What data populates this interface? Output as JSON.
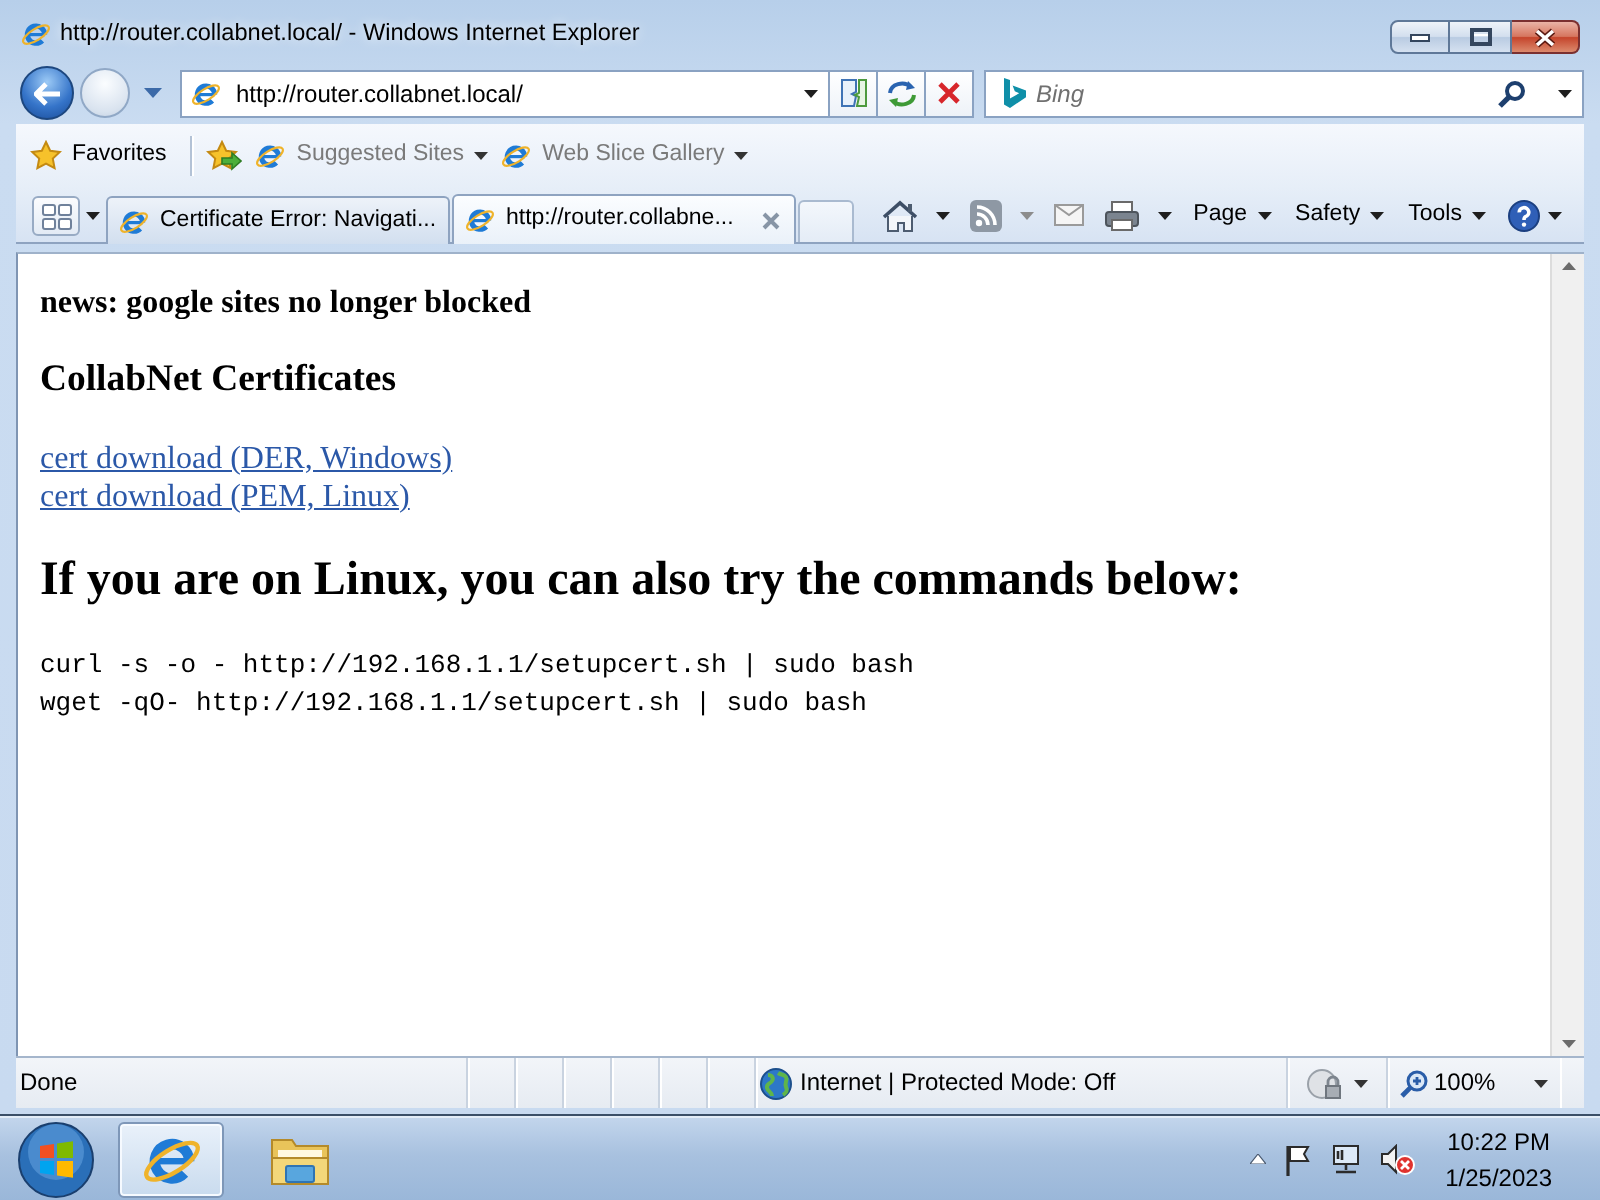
{
  "window": {
    "title": "http://router.collabnet.local/ - Windows Internet Explorer"
  },
  "address_bar": {
    "value": "http://router.collabnet.local/"
  },
  "search": {
    "placeholder": "Bing"
  },
  "favorites_bar": {
    "favorites": "Favorites",
    "items": [
      {
        "label": "Suggested Sites"
      },
      {
        "label": "Web Slice Gallery"
      }
    ]
  },
  "tabs": [
    {
      "label": "Certificate Error: Navigati...",
      "selected": false
    },
    {
      "label": "http://router.collabne...",
      "selected": true
    }
  ],
  "command_bar": {
    "menus": [
      "Page",
      "Safety",
      "Tools"
    ]
  },
  "page": {
    "news": "news: google sites no longer blocked",
    "heading": "CollabNet Certificates",
    "links": [
      "cert download (DER, Windows)",
      "cert download (PEM, Linux)"
    ],
    "linux_heading": "If you are on Linux, you can also try the commands below:",
    "commands": [
      "curl -s -o - http://192.168.1.1/setupcert.sh | sudo bash",
      "wget -qO- http://192.168.1.1/setupcert.sh | sudo bash"
    ]
  },
  "status_bar": {
    "text": "Done",
    "zone": "Internet | Protected Mode: Off",
    "zoom": "100%"
  },
  "taskbar": {
    "apps": [
      {
        "kind": "browser",
        "selected": true
      },
      {
        "kind": "folder",
        "selected": false
      }
    ],
    "time": "10:22 PM",
    "date": "1/25/2023"
  }
}
